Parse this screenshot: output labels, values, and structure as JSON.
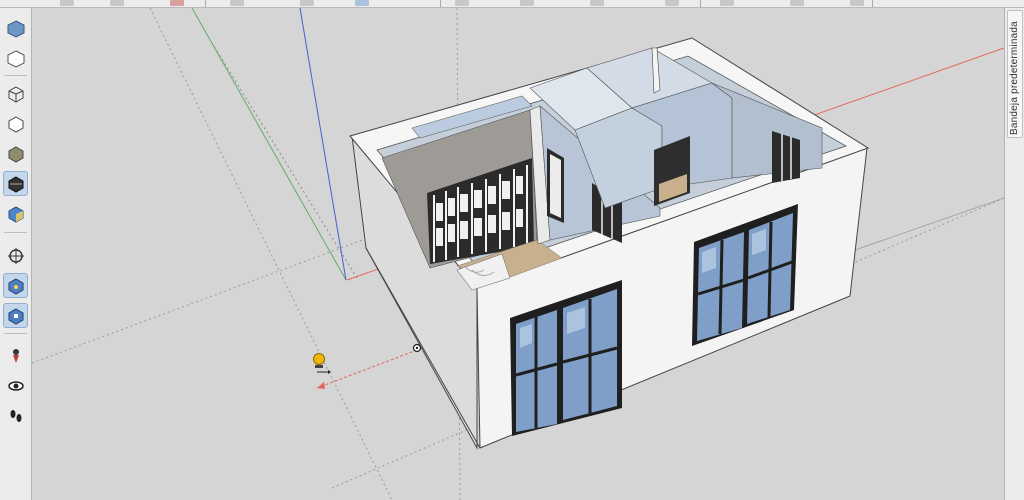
{
  "top_toolbar": {
    "buttons": [
      {
        "icon": "toolbar-button-icon",
        "color": "#d9534f"
      },
      {
        "icon": "toolbar-button-icon",
        "color": "#7a7a7a"
      },
      {
        "icon": "toolbar-button-icon",
        "color": "#5b8fc9"
      },
      {
        "icon": "toolbar-button-icon",
        "color": "#7a7a7a"
      },
      {
        "icon": "toolbar-button-icon",
        "color": "#5b8fc9"
      },
      {
        "icon": "toolbar-button-icon",
        "color": "#7a7a7a"
      },
      {
        "icon": "toolbar-button-icon",
        "color": "#d9534f"
      },
      {
        "icon": "toolbar-button-icon",
        "color": "#7a7a7a"
      }
    ]
  },
  "left_toolbar": {
    "tools": [
      {
        "name": "front-view-icon",
        "active": false
      },
      {
        "name": "top-view-icon",
        "active": false
      },
      {
        "name": "xray-style-icon",
        "active": false
      },
      {
        "name": "wireframe-style-icon",
        "active": false
      },
      {
        "name": "shaded-style-icon",
        "active": false
      },
      {
        "name": "monochrome-style-icon",
        "active": true
      },
      {
        "name": "textured-style-icon",
        "active": false
      },
      {
        "name": "orbit-icon",
        "active": false
      },
      {
        "name": "pan-icon",
        "active": true
      },
      {
        "name": "zoom-icon",
        "active": true
      },
      {
        "name": "position-camera-icon",
        "active": false
      },
      {
        "name": "look-around-icon",
        "active": false
      },
      {
        "name": "walk-icon",
        "active": false
      }
    ]
  },
  "right_tray": {
    "label": "Bandeja predeterminada"
  },
  "colors": {
    "axis_red": "#e5655a",
    "axis_green": "#5fae6c",
    "axis_blue": "#4c5fcf",
    "wall_white": "#f4f4f4",
    "wall_side": "#e3e3e3",
    "glass_blue": "#7f9fc8",
    "floor_wood": "#c9b08d"
  },
  "viewport": {
    "cursor_icon": "tape-measure-cursor-icon"
  }
}
